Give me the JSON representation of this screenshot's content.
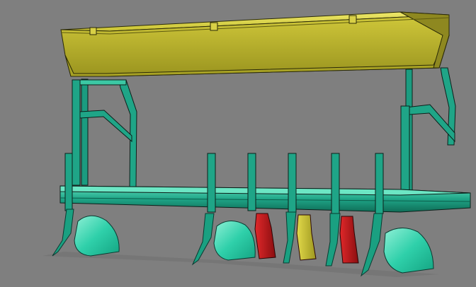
{
  "scene": {
    "colors": {
      "background": "#7f7f7f",
      "hopper": "#c9c232",
      "hopper_light": "#e2dc4a",
      "hopper_dark": "#8e8820",
      "frame": "#1fa587",
      "frame_dark": "#11705a",
      "frame_light": "#3cc8a4",
      "moldboard": "#22c9a4",
      "moldboard_light": "#8ff0d6",
      "shoe_red": "#c8191c",
      "shoe_red_dark": "#7d0c0e",
      "shoe_yellow": "#c6be2a",
      "outline": "#0c1f1a",
      "shadow": "#6a6a6a"
    },
    "components": [
      "seed-hopper",
      "tool-frame",
      "plow-bodies",
      "seed-shoes"
    ]
  }
}
